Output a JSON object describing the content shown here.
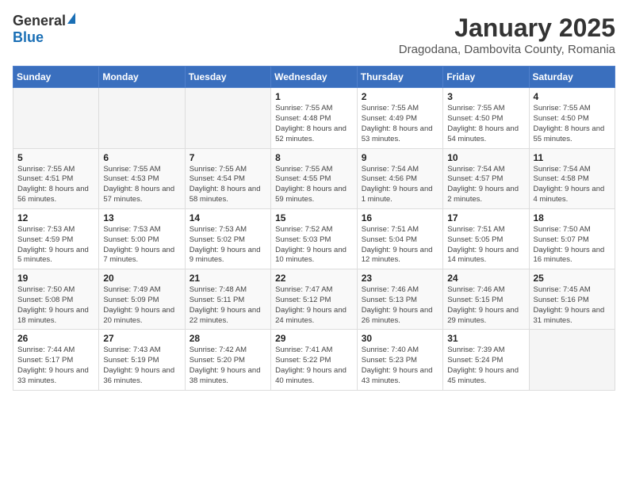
{
  "logo": {
    "general": "General",
    "blue": "Blue"
  },
  "title": {
    "month": "January 2025",
    "location": "Dragodana, Dambovita County, Romania"
  },
  "weekdays": [
    "Sunday",
    "Monday",
    "Tuesday",
    "Wednesday",
    "Thursday",
    "Friday",
    "Saturday"
  ],
  "weeks": [
    [
      {
        "day": "",
        "info": ""
      },
      {
        "day": "",
        "info": ""
      },
      {
        "day": "",
        "info": ""
      },
      {
        "day": "1",
        "info": "Sunrise: 7:55 AM\nSunset: 4:48 PM\nDaylight: 8 hours and 52 minutes."
      },
      {
        "day": "2",
        "info": "Sunrise: 7:55 AM\nSunset: 4:49 PM\nDaylight: 8 hours and 53 minutes."
      },
      {
        "day": "3",
        "info": "Sunrise: 7:55 AM\nSunset: 4:50 PM\nDaylight: 8 hours and 54 minutes."
      },
      {
        "day": "4",
        "info": "Sunrise: 7:55 AM\nSunset: 4:50 PM\nDaylight: 8 hours and 55 minutes."
      }
    ],
    [
      {
        "day": "5",
        "info": "Sunrise: 7:55 AM\nSunset: 4:51 PM\nDaylight: 8 hours and 56 minutes."
      },
      {
        "day": "6",
        "info": "Sunrise: 7:55 AM\nSunset: 4:53 PM\nDaylight: 8 hours and 57 minutes."
      },
      {
        "day": "7",
        "info": "Sunrise: 7:55 AM\nSunset: 4:54 PM\nDaylight: 8 hours and 58 minutes."
      },
      {
        "day": "8",
        "info": "Sunrise: 7:55 AM\nSunset: 4:55 PM\nDaylight: 8 hours and 59 minutes."
      },
      {
        "day": "9",
        "info": "Sunrise: 7:54 AM\nSunset: 4:56 PM\nDaylight: 9 hours and 1 minute."
      },
      {
        "day": "10",
        "info": "Sunrise: 7:54 AM\nSunset: 4:57 PM\nDaylight: 9 hours and 2 minutes."
      },
      {
        "day": "11",
        "info": "Sunrise: 7:54 AM\nSunset: 4:58 PM\nDaylight: 9 hours and 4 minutes."
      }
    ],
    [
      {
        "day": "12",
        "info": "Sunrise: 7:53 AM\nSunset: 4:59 PM\nDaylight: 9 hours and 5 minutes."
      },
      {
        "day": "13",
        "info": "Sunrise: 7:53 AM\nSunset: 5:00 PM\nDaylight: 9 hours and 7 minutes."
      },
      {
        "day": "14",
        "info": "Sunrise: 7:53 AM\nSunset: 5:02 PM\nDaylight: 9 hours and 9 minutes."
      },
      {
        "day": "15",
        "info": "Sunrise: 7:52 AM\nSunset: 5:03 PM\nDaylight: 9 hours and 10 minutes."
      },
      {
        "day": "16",
        "info": "Sunrise: 7:51 AM\nSunset: 5:04 PM\nDaylight: 9 hours and 12 minutes."
      },
      {
        "day": "17",
        "info": "Sunrise: 7:51 AM\nSunset: 5:05 PM\nDaylight: 9 hours and 14 minutes."
      },
      {
        "day": "18",
        "info": "Sunrise: 7:50 AM\nSunset: 5:07 PM\nDaylight: 9 hours and 16 minutes."
      }
    ],
    [
      {
        "day": "19",
        "info": "Sunrise: 7:50 AM\nSunset: 5:08 PM\nDaylight: 9 hours and 18 minutes."
      },
      {
        "day": "20",
        "info": "Sunrise: 7:49 AM\nSunset: 5:09 PM\nDaylight: 9 hours and 20 minutes."
      },
      {
        "day": "21",
        "info": "Sunrise: 7:48 AM\nSunset: 5:11 PM\nDaylight: 9 hours and 22 minutes."
      },
      {
        "day": "22",
        "info": "Sunrise: 7:47 AM\nSunset: 5:12 PM\nDaylight: 9 hours and 24 minutes."
      },
      {
        "day": "23",
        "info": "Sunrise: 7:46 AM\nSunset: 5:13 PM\nDaylight: 9 hours and 26 minutes."
      },
      {
        "day": "24",
        "info": "Sunrise: 7:46 AM\nSunset: 5:15 PM\nDaylight: 9 hours and 29 minutes."
      },
      {
        "day": "25",
        "info": "Sunrise: 7:45 AM\nSunset: 5:16 PM\nDaylight: 9 hours and 31 minutes."
      }
    ],
    [
      {
        "day": "26",
        "info": "Sunrise: 7:44 AM\nSunset: 5:17 PM\nDaylight: 9 hours and 33 minutes."
      },
      {
        "day": "27",
        "info": "Sunrise: 7:43 AM\nSunset: 5:19 PM\nDaylight: 9 hours and 36 minutes."
      },
      {
        "day": "28",
        "info": "Sunrise: 7:42 AM\nSunset: 5:20 PM\nDaylight: 9 hours and 38 minutes."
      },
      {
        "day": "29",
        "info": "Sunrise: 7:41 AM\nSunset: 5:22 PM\nDaylight: 9 hours and 40 minutes."
      },
      {
        "day": "30",
        "info": "Sunrise: 7:40 AM\nSunset: 5:23 PM\nDaylight: 9 hours and 43 minutes."
      },
      {
        "day": "31",
        "info": "Sunrise: 7:39 AM\nSunset: 5:24 PM\nDaylight: 9 hours and 45 minutes."
      },
      {
        "day": "",
        "info": ""
      }
    ]
  ]
}
